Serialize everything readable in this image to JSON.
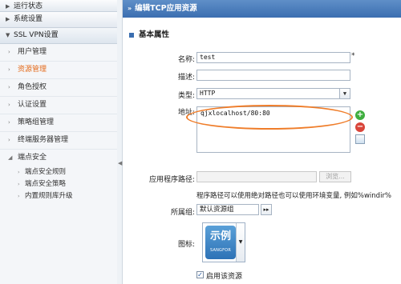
{
  "sidebar": {
    "sections": [
      {
        "label": "运行状态"
      },
      {
        "label": "系统设置"
      },
      {
        "label": "SSL VPN设置"
      }
    ],
    "items": [
      {
        "label": "用户管理"
      },
      {
        "label": "资源管理"
      },
      {
        "label": "角色授权"
      },
      {
        "label": "认证设置"
      },
      {
        "label": "策略组管理"
      },
      {
        "label": "终端服务器管理"
      },
      {
        "label": "端点安全"
      }
    ],
    "children": [
      {
        "label": "端点安全规则"
      },
      {
        "label": "端点安全策略"
      },
      {
        "label": "内置规则库升级"
      }
    ]
  },
  "header": {
    "title": "编辑TCP应用资源"
  },
  "section": {
    "title": "基本属性"
  },
  "form": {
    "name_label": "名称:",
    "name_value": "test",
    "required_mark": "*",
    "desc_label": "描述:",
    "desc_value": "",
    "type_label": "类型:",
    "type_value": "HTTP",
    "address_label": "地址:",
    "address_value": "qjxlocalhost/80:80",
    "app_path_label": "应用程序路径:",
    "app_path_value": "",
    "browse_label": "浏览...",
    "hint": "程序路径可以使用绝对路径也可以使用环境变量, 例如%windir%",
    "group_label": "所属组:",
    "group_value": "默认资源组",
    "icon_label": "图标:",
    "icon_text": "示例",
    "icon_subtext": "SANGFOR",
    "enable_label": "启用该资源",
    "enable_checked": true
  },
  "colors": {
    "accent": "#3b6eb0",
    "active_item": "#e46a1a",
    "highlight_oval": "#ef7d2a"
  }
}
